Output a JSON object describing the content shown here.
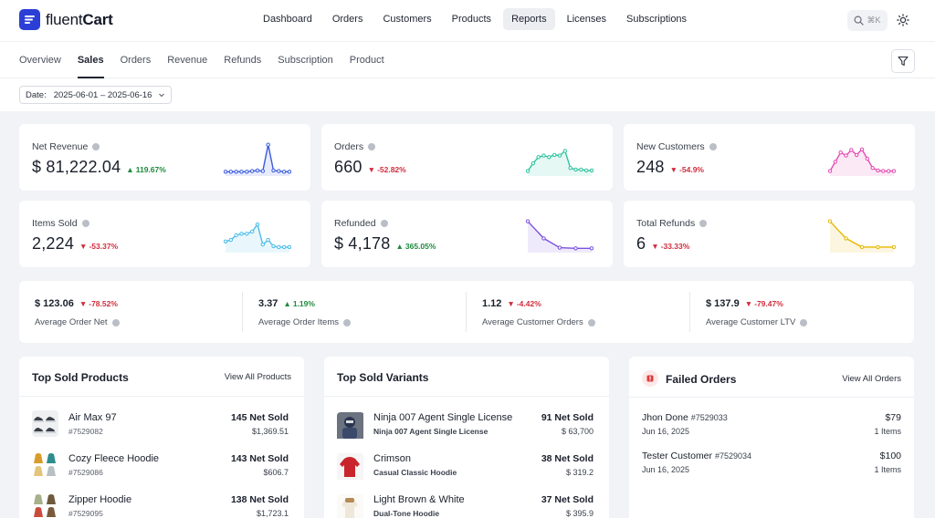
{
  "app": {
    "logo_text_bold": "Cart",
    "logo_text_light": "fluent"
  },
  "topnav": [
    {
      "label": "Dashboard",
      "active": false
    },
    {
      "label": "Orders",
      "active": false
    },
    {
      "label": "Customers",
      "active": false
    },
    {
      "label": "Products",
      "active": false
    },
    {
      "label": "Reports",
      "active": true
    },
    {
      "label": "Licenses",
      "active": false
    },
    {
      "label": "Subscriptions",
      "active": false
    }
  ],
  "search": {
    "shortcut": "⌘K",
    "icon": "search-icon"
  },
  "theme": {
    "icon": "sun-icon"
  },
  "subnav": [
    {
      "label": "Overview",
      "active": false
    },
    {
      "label": "Sales",
      "active": true
    },
    {
      "label": "Orders",
      "active": false
    },
    {
      "label": "Revenue",
      "active": false
    },
    {
      "label": "Refunds",
      "active": false
    },
    {
      "label": "Subscription",
      "active": false
    },
    {
      "label": "Product",
      "active": false
    }
  ],
  "filter": {
    "icon": "filter-icon"
  },
  "date_filter": {
    "label": "Date:",
    "value": "2025-06-01 – 2025-06-16"
  },
  "kpis": [
    {
      "label": "Net Revenue",
      "value": "$ 81,222.04",
      "change": "119.67%",
      "direction": "up",
      "color": "#3b5bdb",
      "spark": [
        0.08,
        0.08,
        0.08,
        0.08,
        0.08,
        0.1,
        0.12,
        0.1,
        0.95,
        0.12,
        0.1,
        0.08,
        0.08
      ]
    },
    {
      "label": "Orders",
      "value": "660",
      "change": "-52.82%",
      "direction": "down",
      "color": "#2ec4a0",
      "spark": [
        0.1,
        0.35,
        0.55,
        0.6,
        0.55,
        0.62,
        0.6,
        0.75,
        0.2,
        0.15,
        0.15,
        0.12,
        0.12
      ]
    },
    {
      "label": "New Customers",
      "value": "248",
      "change": "-54.9%",
      "direction": "down",
      "color": "#e64cb2",
      "spark": [
        0.1,
        0.4,
        0.7,
        0.6,
        0.78,
        0.62,
        0.8,
        0.5,
        0.2,
        0.12,
        0.1,
        0.1,
        0.1
      ]
    },
    {
      "label": "Items Sold",
      "value": "2,224",
      "change": "-53.37%",
      "direction": "down",
      "color": "#4dbde8",
      "spark": [
        0.3,
        0.35,
        0.5,
        0.55,
        0.55,
        0.62,
        0.85,
        0.2,
        0.35,
        0.15,
        0.12,
        0.12,
        0.12
      ]
    },
    {
      "label": "Refunded",
      "value": "$ 4,178",
      "change": "365.05%",
      "direction": "up",
      "color": "#7b52e0",
      "spark": [
        0.95,
        0.4,
        0.1,
        0.08,
        0.08
      ]
    },
    {
      "label": "Total Refunds",
      "value": "6",
      "change": "-33.33%",
      "direction": "down",
      "color": "#e8b800",
      "spark": [
        0.95,
        0.4,
        0.12,
        0.12,
        0.12
      ]
    }
  ],
  "stats": [
    {
      "value": "$ 123.06",
      "change": "-78.52%",
      "direction": "down",
      "label": "Average Order Net"
    },
    {
      "value": "3.37",
      "change": "1.19%",
      "direction": "up",
      "label": "Average Order Items"
    },
    {
      "value": "1.12",
      "change": "-4.42%",
      "direction": "down",
      "label": "Average Customer Orders"
    },
    {
      "value": "$ 137.9",
      "change": "-79.47%",
      "direction": "down",
      "label": "Average Customer LTV"
    }
  ],
  "top_products": {
    "title": "Top Sold Products",
    "link": "View All Products",
    "items": [
      {
        "name": "Air Max 97",
        "sub": "#7529082",
        "qty": "145 Net Sold",
        "amount": "$1,369.51",
        "thumb": "sneaker"
      },
      {
        "name": "Cozy Fleece Hoodie",
        "sub": "#7529086",
        "qty": "143 Net Sold",
        "amount": "$606.7",
        "thumb": "hoodies"
      },
      {
        "name": "Zipper Hoodie",
        "sub": "#7529095",
        "qty": "138 Net Sold",
        "amount": "$1,723.1",
        "thumb": "zipper"
      }
    ]
  },
  "top_variants": {
    "title": "Top Sold Variants",
    "items": [
      {
        "name": "Ninja 007 Agent Single License",
        "sub": "Ninja 007 Agent Single License",
        "qty": "91 Net Sold",
        "amount": "$ 63,700",
        "thumb": "ninja"
      },
      {
        "name": "Crimson",
        "sub": "Casual Classic Hoodie",
        "qty": "38 Net Sold",
        "amount": "$ 319.2",
        "thumb": "crimson"
      },
      {
        "name": "Light Brown & White",
        "sub": "Dual-Tone Hoodie",
        "qty": "37 Net Sold",
        "amount": "$ 395.9",
        "thumb": "lightbrown"
      }
    ]
  },
  "failed_orders": {
    "title": "Failed Orders",
    "link": "View All Orders",
    "items": [
      {
        "name": "Jhon Done",
        "id": "#7529033",
        "date": "Jun 16, 2025",
        "amount": "$79",
        "items": "1 Items"
      },
      {
        "name": "Tester Customer",
        "id": "#7529034",
        "date": "Jun 16, 2025",
        "amount": "$100",
        "items": "1 Items"
      }
    ]
  }
}
